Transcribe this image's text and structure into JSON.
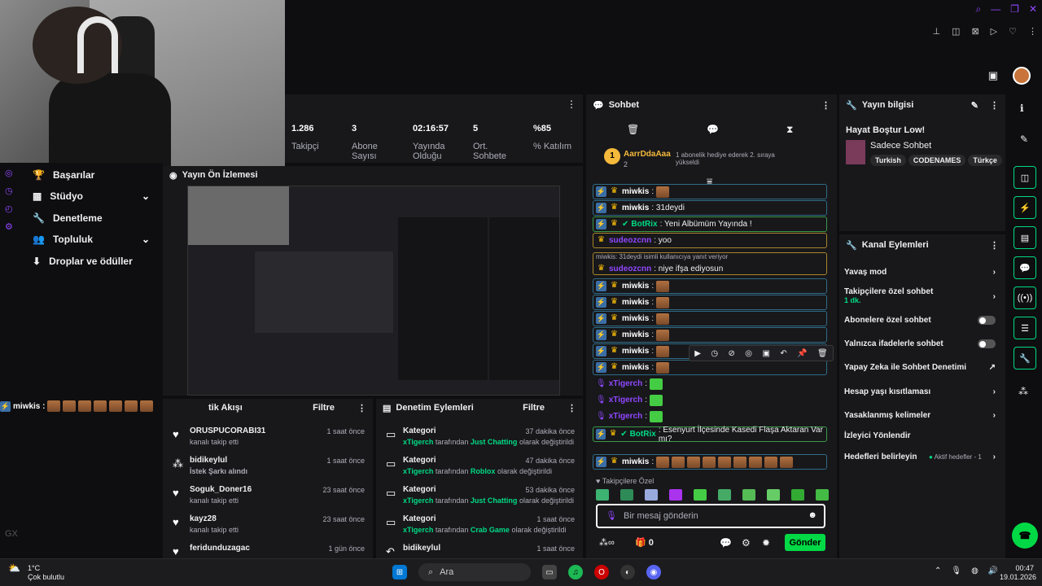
{
  "stats": [
    {
      "value": "1.286",
      "label": "Takipçi"
    },
    {
      "value": "3",
      "label": "Abone Sayısı"
    },
    {
      "value": "02:16:57",
      "label": "Yayında Olduğu"
    },
    {
      "value": "5",
      "label": "Ort. Sohbete"
    },
    {
      "value": "%85",
      "label": "% Katılım"
    }
  ],
  "nav": {
    "items": [
      {
        "label": "Başarılar"
      },
      {
        "label": "Stüdyo"
      },
      {
        "label": "Denetleme"
      },
      {
        "label": "Topluluk"
      },
      {
        "label": "Droplar ve ödüller"
      }
    ]
  },
  "preview": {
    "title": "Yayın Ön İzlemesi"
  },
  "strip": {
    "user": "miwkis :"
  },
  "activity": {
    "title": "tik Akışı",
    "filter": "Filtre",
    "rows": [
      {
        "name": "ORUSPUCORABI31",
        "desc": "kanalı takip etti",
        "time": "1 saat önce"
      },
      {
        "name": "bidikeylul",
        "desc": "İstek Şarkı alındı",
        "time": "1 saat önce"
      },
      {
        "name": "Soguk_Doner16",
        "desc": "kanalı takip etti",
        "time": "23 saat önce"
      },
      {
        "name": "kayz28",
        "desc": "kanalı takip etti",
        "time": "23 saat önce"
      },
      {
        "name": "feridunduzagac",
        "desc": "",
        "time": "1 gün önce"
      }
    ]
  },
  "modlog": {
    "title": "Denetim Eylemleri",
    "filter": "Filtre",
    "rows": [
      {
        "name": "Kategori",
        "user": "xTigerch",
        "mid": "tarafından",
        "cat": "Just Chatting",
        "end": "olarak değiştirildi",
        "time": "37 dakika önce"
      },
      {
        "name": "Kategori",
        "user": "xTigerch",
        "mid": "tarafından",
        "cat": "Roblox",
        "end": "olarak değiştirildi",
        "time": "47 dakika önce"
      },
      {
        "name": "Kategori",
        "user": "xTigerch",
        "mid": "tarafından",
        "cat": "Just Chatting",
        "end": "olarak değiştirildi",
        "time": "53 dakika önce"
      },
      {
        "name": "Kategori",
        "user": "xTigerch",
        "mid": "tarafından",
        "cat": "Crab Game",
        "end": "olarak değiştirildi",
        "time": "1 saat önce"
      },
      {
        "name": "bidikeylul",
        "user": "",
        "mid": "",
        "cat": "",
        "end": "",
        "time": "1 saat önce"
      }
    ]
  },
  "chat": {
    "title": "Sohbet",
    "gifter": {
      "name": "AarrDdaAaa",
      "count": "2",
      "note": "1 abonelik hediye ederek 2. sıraya yükseldi"
    },
    "messages": [
      {
        "user": "miwkis",
        "text": ":",
        "type": "sub"
      },
      {
        "user": "miwkis",
        "text": ": 31deydi",
        "type": "sub"
      },
      {
        "user": "BotRix",
        "text": ": Yeni Albümüm Yayında !",
        "type": "bot"
      },
      {
        "user": "sudeozcnn",
        "text": ": yoo",
        "type": "gold"
      },
      {
        "user": "sudeozcnn",
        "text": ": niye ifşa ediyosun",
        "type": "reply",
        "reply": "miwkis: 31deydi isimli kullanıcıya yanıt veriyor"
      },
      {
        "user": "miwkis",
        "text": ":",
        "type": "sub"
      },
      {
        "user": "miwkis",
        "text": ":",
        "type": "sub"
      },
      {
        "user": "miwkis",
        "text": ":",
        "type": "sub"
      },
      {
        "user": "miwkis",
        "text": ":",
        "type": "sub"
      },
      {
        "user": "miwkis",
        "text": ":",
        "type": "sub"
      },
      {
        "user": "miwkis",
        "text": ":",
        "type": "sub"
      },
      {
        "user": "xTigerch",
        "text": ":",
        "type": "mod"
      },
      {
        "user": "xTigerch",
        "text": ":",
        "type": "mod"
      },
      {
        "user": "xTigerch",
        "text": ":",
        "type": "mod"
      },
      {
        "user": "BotRix",
        "text": ": Esenyurt İlçesinde Kasedi Flaşa Aktaran Var mı?",
        "type": "bot"
      },
      {
        "user": "miwkis",
        "text": ":",
        "type": "sub"
      }
    ],
    "followers_only": "Takipçilere Özel",
    "placeholder": "Bir mesaj gönderin",
    "points": "0",
    "send": "Gönder"
  },
  "info": {
    "title": "Yayın bilgisi",
    "stream_title": "Hayat Boştur Low!",
    "category": "Sadece Sohbet",
    "tags": [
      "Turkish",
      "CODENAMES",
      "Türkçe"
    ]
  },
  "actions": {
    "title": "Kanal Eylemleri",
    "items": [
      {
        "label": "Yavaş mod",
        "sub": "",
        "kind": "chevron"
      },
      {
        "label": "Takipçilere özel sohbet",
        "sub": "1 dk.",
        "kind": "chevron"
      },
      {
        "label": "Abonelere özel sohbet",
        "sub": "",
        "kind": "toggle"
      },
      {
        "label": "Yalnızca ifadelerle sohbet",
        "sub": "",
        "kind": "toggle"
      },
      {
        "label": "Yapay Zeka ile Sohbet Denetimi",
        "sub": "",
        "kind": "external"
      },
      {
        "label": "Hesap yaşı kısıtlaması",
        "sub": "",
        "kind": "chevron"
      },
      {
        "label": "Yasaklanmış kelimeler",
        "sub": "",
        "kind": "chevron"
      },
      {
        "label": "İzleyici Yönlendir",
        "sub": "",
        "kind": "none"
      },
      {
        "label": "Hedefleri belirleyin",
        "sub": "",
        "kind": "goal",
        "extra": "Aktif hedefler - 1"
      }
    ]
  },
  "taskbar": {
    "weather_temp": "1°C",
    "weather_desc": "Çok bulutlu",
    "search": "Ara",
    "time": "00:47",
    "date": "19.01.2026"
  },
  "colors": {
    "accent": "#00db84",
    "brand": "#9147ff",
    "send": "#00d945"
  }
}
